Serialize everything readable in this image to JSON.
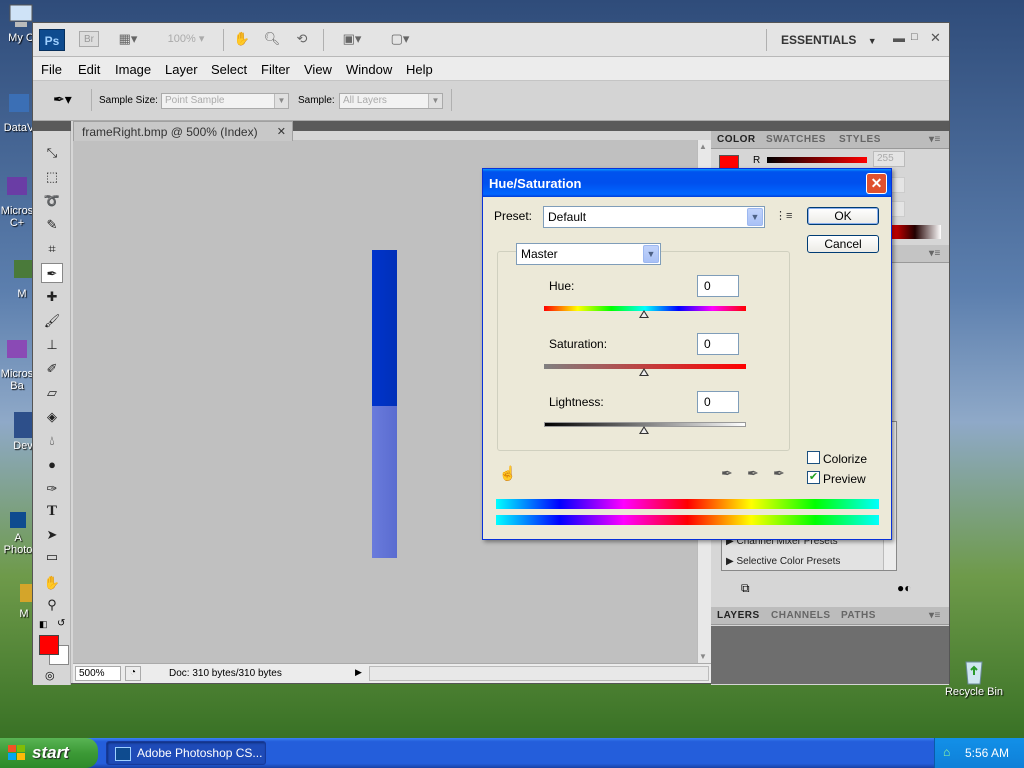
{
  "desktop": {
    "icons": [
      {
        "label": "My C"
      },
      {
        "label": "DataV"
      },
      {
        "label": "Micros C+"
      },
      {
        "label": "M"
      },
      {
        "label": "Micros Ba"
      },
      {
        "label": "Dev"
      },
      {
        "label": "A Photo"
      },
      {
        "label": "M"
      },
      {
        "label": "Recycle Bin"
      }
    ]
  },
  "photoshop": {
    "logo": "Ps",
    "bridge": "Br",
    "zoom_value": "100%",
    "workspace": "ESSENTIALS",
    "menu": [
      "File",
      "Edit",
      "Image",
      "Layer",
      "Select",
      "Filter",
      "View",
      "Window",
      "Help"
    ],
    "options": {
      "sample_size_label": "Sample Size:",
      "sample_size_value": "Point Sample",
      "sample_label": "Sample:",
      "sample_value": "All Layers"
    },
    "document_tab": "frameRight.bmp @ 500% (Index)",
    "status": {
      "zoom": "500%",
      "doc": "Doc: 310 bytes/310 bytes"
    },
    "color_panel": {
      "tabs": [
        "COLOR",
        "SWATCHES",
        "STYLES"
      ],
      "r_label": "R",
      "r_value": "255"
    },
    "adjustments_list": [
      "Channel Mixer Presets",
      "Selective Color Presets"
    ],
    "layers_panel": {
      "tabs": [
        "LAYERS",
        "CHANNELS",
        "PATHS"
      ]
    },
    "fg_color": "#ff0000",
    "bg_color": "#ffffff",
    "canvas_colors": {
      "top": "#0033cc",
      "bottom": "#6a7bdc"
    }
  },
  "dialog": {
    "title": "Hue/Saturation",
    "preset_label": "Preset:",
    "preset_value": "Default",
    "ok": "OK",
    "cancel": "Cancel",
    "channel": "Master",
    "hue_label": "Hue:",
    "hue_value": "0",
    "saturation_label": "Saturation:",
    "saturation_value": "0",
    "lightness_label": "Lightness:",
    "lightness_value": "0",
    "colorize_label": "Colorize",
    "colorize_checked": false,
    "preview_label": "Preview",
    "preview_checked": true
  },
  "taskbar": {
    "start": "start",
    "task": "Adobe Photoshop CS...",
    "clock": "5:56 AM"
  }
}
